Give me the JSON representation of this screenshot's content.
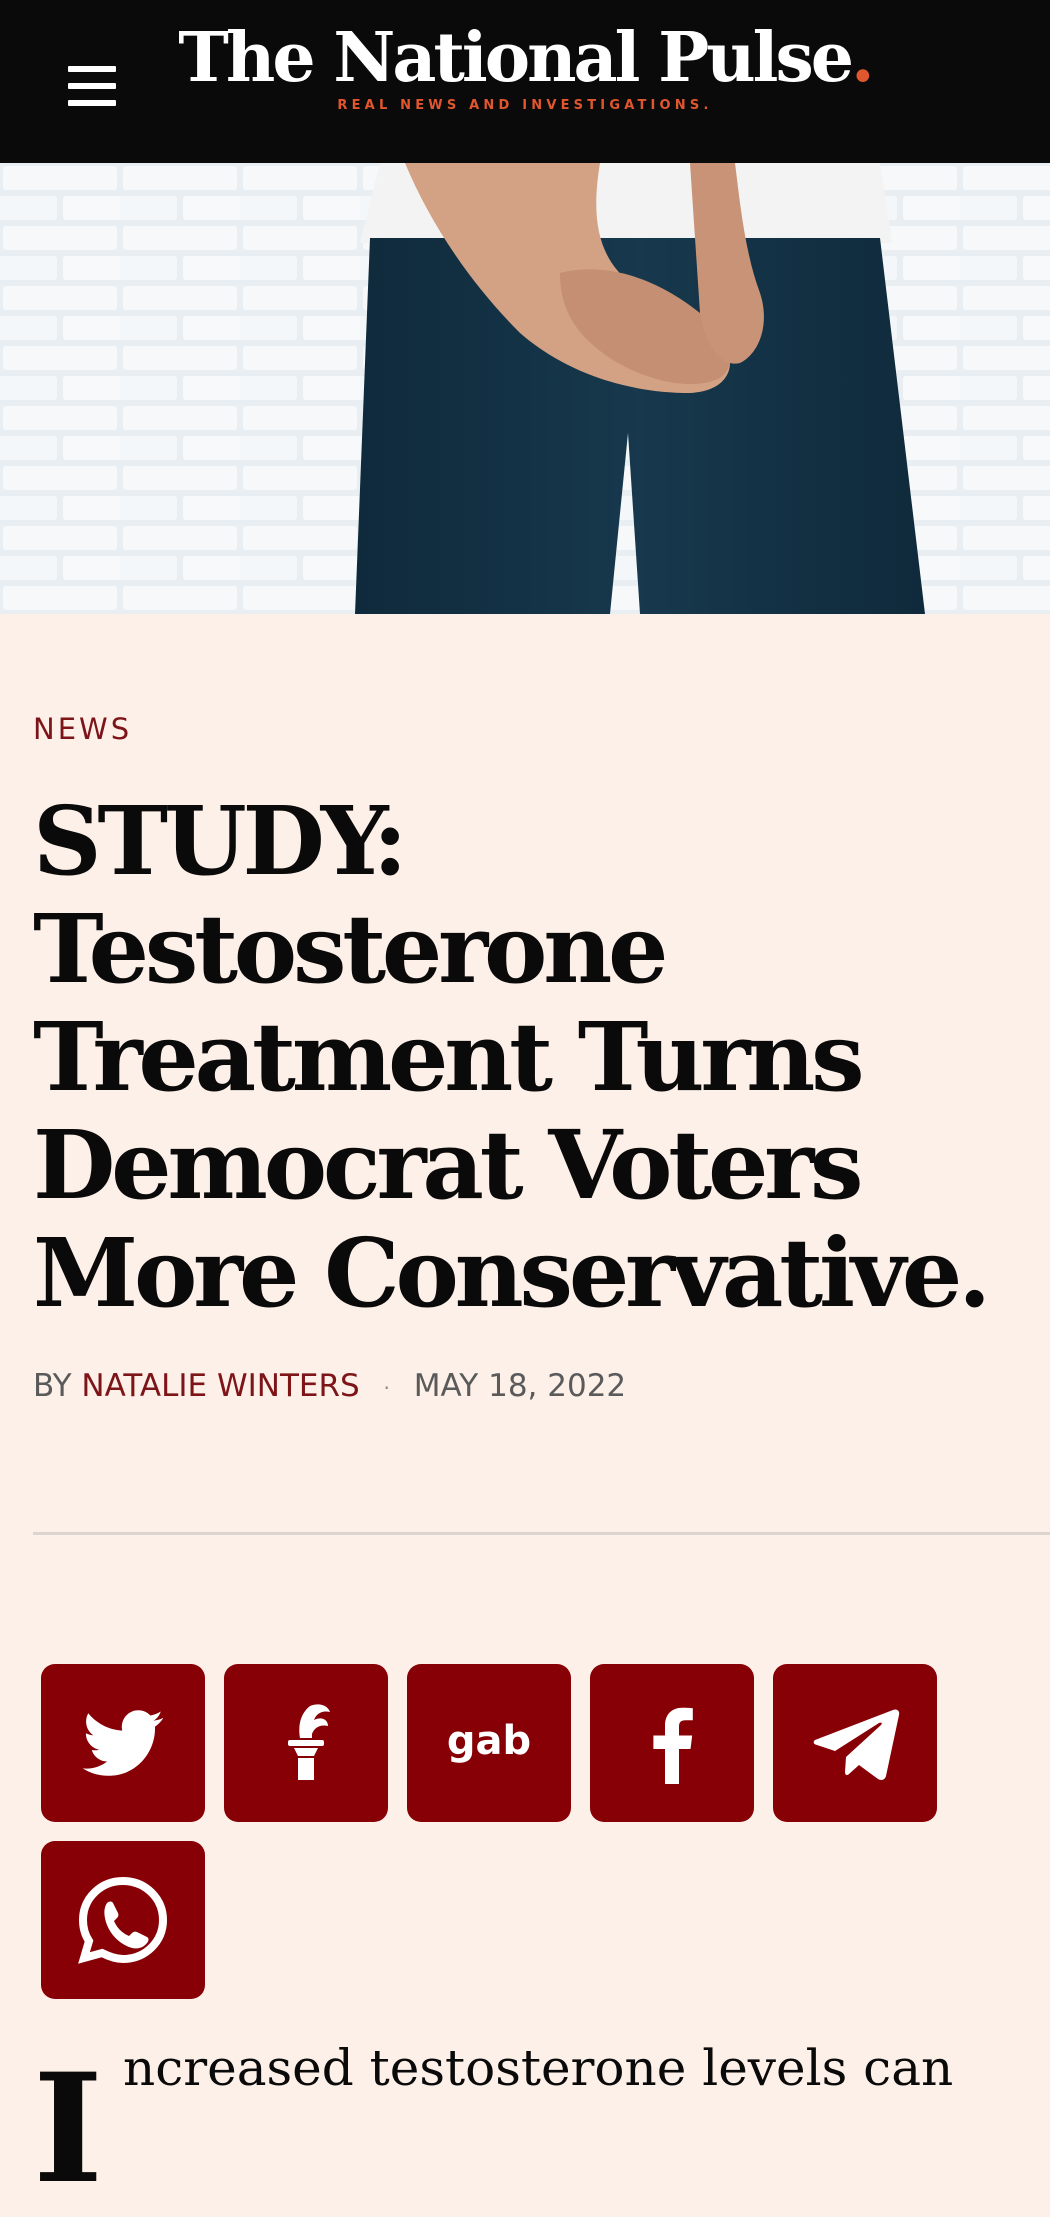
{
  "header": {
    "logo_title": "The National Pulse",
    "logo_dot": ".",
    "tagline": "REAL NEWS AND INVESTIGATIONS."
  },
  "hero_image": {
    "alt": "Person standing in front of a white brick wall"
  },
  "article": {
    "category": "NEWS",
    "headline": "STUDY: Testosterone Treatment Turns Democrat Voters More Conservative.",
    "byline_prefix": "BY",
    "author": "NATALIE WINTERS",
    "separator": "·",
    "date": "MAY 18, 2022",
    "dropcap": "I",
    "lead_text": "ncreased testosterone levels can"
  },
  "share_buttons": [
    {
      "icon": "twitter-icon"
    },
    {
      "icon": "gettr-icon"
    },
    {
      "icon": "gab-icon",
      "label": "gab"
    },
    {
      "icon": "facebook-icon"
    },
    {
      "icon": "telegram-icon"
    },
    {
      "icon": "whatsapp-icon"
    }
  ],
  "colors": {
    "header_bg": "#0b0a0a",
    "accent": "#e0562e",
    "brand_red": "#870006",
    "category_red": "#7c1418",
    "page_bg": "#fdf0e8"
  }
}
